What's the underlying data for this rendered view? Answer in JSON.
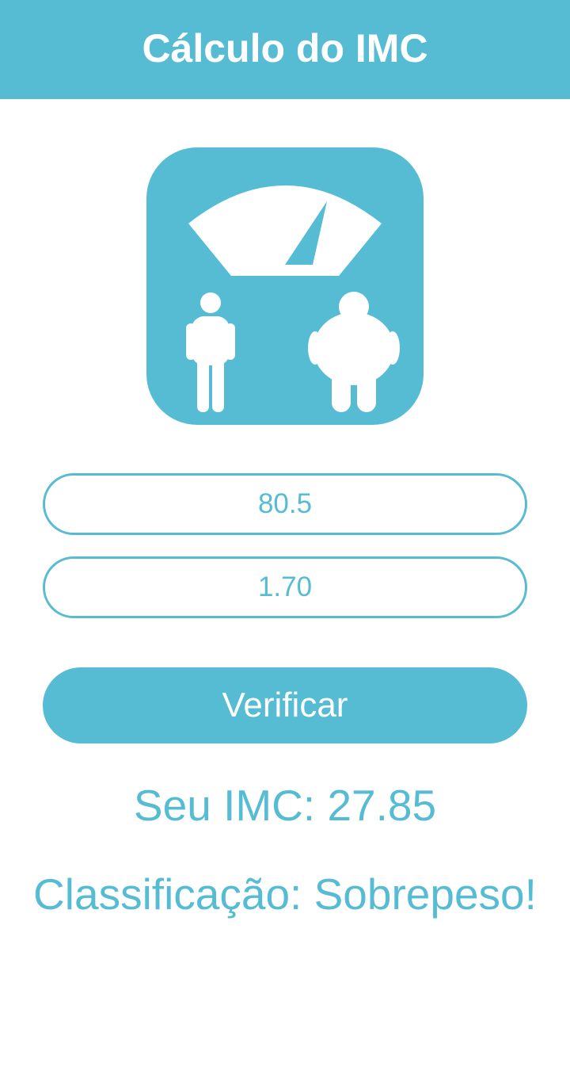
{
  "header": {
    "title": "Cálculo do IMC"
  },
  "logo": {
    "icon": "bmi-scale-icon",
    "color": "#56BCD4"
  },
  "form": {
    "weight_value": "80.5",
    "height_value": "1.70",
    "verify_label": "Verificar"
  },
  "result": {
    "imc_text": "Seu IMC: 27.85",
    "classification_text": "Classificação: Sobrepeso!"
  },
  "colors": {
    "accent": "#56BCD4",
    "background": "#FFFFFF",
    "on_accent": "#FFFFFF"
  }
}
